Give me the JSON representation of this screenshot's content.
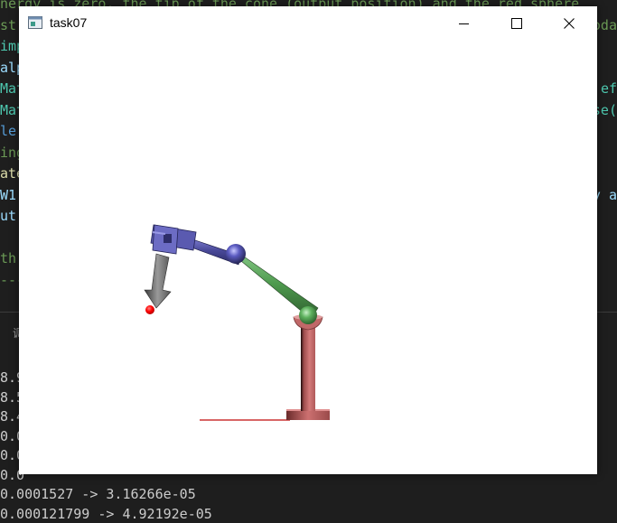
{
  "editor": {
    "lines": [
      {
        "text": "nergy is zero, the tip of the cone (output position) and the red sphere",
        "color": "#6a9955"
      },
      {
        "text": "st",
        "color": "#6a9955",
        "right": "oda"
      },
      {
        "text": "imp",
        "color": "#4ec9b0"
      },
      {
        "text": "alp",
        "color": "#9cdcfe"
      },
      {
        "text": "Mat",
        "color": "#4ec9b0",
        "right": "ef"
      },
      {
        "text": "Mat",
        "color": "#4ec9b0",
        "right": "se("
      },
      {
        "text": "le",
        "color": "#569cd6"
      },
      {
        "text": "ing",
        "color": "#6a9955"
      },
      {
        "text": "ate",
        "color": "#dcdcaa"
      },
      {
        "text": "W1",
        "color": "#9cdcfe",
        "right": "y a"
      },
      {
        "text": "ut",
        "color": "#9cdcfe"
      },
      {
        "text": "",
        "color": "#6a9955"
      },
      {
        "text": "th",
        "color": "#6a9955"
      },
      {
        "text": "---",
        "color": "#6a9955"
      }
    ]
  },
  "panel": {
    "tab_label": "调"
  },
  "terminal": {
    "lines": [
      "8.9",
      "8.5",
      "8.4",
      "0.0",
      "0.0",
      "0.0",
      "0.0001527 -> 3.16266e-05",
      "0.000121799 -> 4.92192e-05"
    ]
  },
  "window": {
    "title": "task07",
    "icon": "app-window-icon",
    "controls": [
      "minimize-icon",
      "maximize-icon",
      "close-icon"
    ]
  },
  "scene": {
    "colors": {
      "base": "#cc6e6e",
      "base_shadow": "#7a2a2a",
      "upper_arm": "#4e9a4e",
      "joint_green": "#5fb25f",
      "forearm": "#5a5aaa",
      "joint_blue": "#6767c8",
      "cone": "#7a7a7a",
      "target": "#ff0000",
      "ground": "#cc3333"
    }
  }
}
